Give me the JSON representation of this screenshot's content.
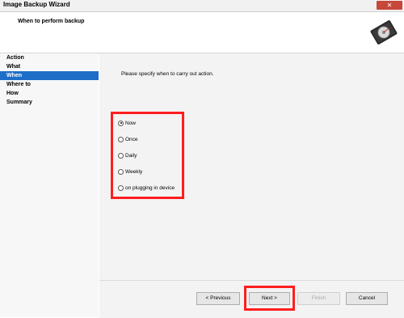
{
  "window": {
    "title": "Image Backup Wizard",
    "close_label": "✕"
  },
  "header": {
    "step_title": "When to perform backup",
    "icon": "hard-disk-icon"
  },
  "sidebar": {
    "items": [
      {
        "label": "Action"
      },
      {
        "label": "What"
      },
      {
        "label": "When"
      },
      {
        "label": "Where to"
      },
      {
        "label": "How"
      },
      {
        "label": "Summary"
      }
    ],
    "active": "When"
  },
  "main": {
    "instruction": "Please specify when to carry out action.",
    "options": [
      {
        "label": "Now",
        "checked": true
      },
      {
        "label": "Once",
        "checked": false
      },
      {
        "label": "Daily",
        "checked": false
      },
      {
        "label": "Weekly",
        "checked": false
      },
      {
        "label": "on plugging in device",
        "checked": false
      }
    ]
  },
  "footer": {
    "previous_label": "< Previous",
    "next_label": "Next >",
    "finish_label": "Finish",
    "cancel_label": "Cancel"
  },
  "colors": {
    "highlight": "#ff1e1e",
    "selection": "#1e6ec8",
    "close_button": "#c7473b"
  }
}
